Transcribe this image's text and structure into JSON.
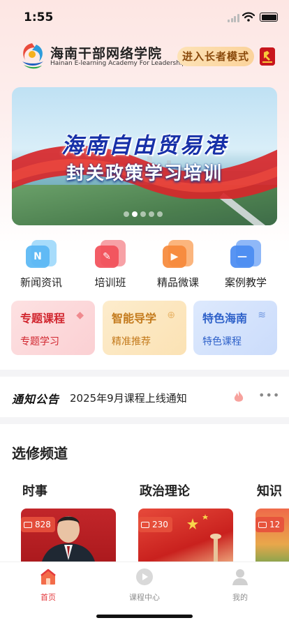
{
  "status_bar": {
    "time": "1:55"
  },
  "header": {
    "brand_cn": "海南干部网络学院",
    "brand_en": "Hainan E-learning Academy For Leadership",
    "elder_mode_label": "进入长者模式",
    "colors": {
      "accent": "#e4393c",
      "elder_btn": "#fbd39b",
      "party_badge": "#c8161d"
    }
  },
  "banner": {
    "title_line1": "海南自由贸易港",
    "title_line2": "封关政策学习培训",
    "slide_count": 5,
    "active_slide": 1
  },
  "quick_menu": [
    {
      "label": "新闻资讯",
      "icon": "news-icon",
      "glyph": "N",
      "color": "#5ab8f5"
    },
    {
      "label": "培训班",
      "icon": "training-class-icon",
      "glyph": "✎",
      "color": "#f2505a"
    },
    {
      "label": "精品微课",
      "icon": "micro-course-icon",
      "glyph": "▶",
      "color": "#f7893a"
    },
    {
      "label": "案例教学",
      "icon": "case-teaching-icon",
      "glyph": "—",
      "color": "#4a8cf2"
    }
  ],
  "feature_cards": [
    {
      "title": "专题课程",
      "subtitle": "专题学习",
      "icon": "tag-icon",
      "glyph": "◆",
      "bg": "#fde1e2",
      "fg": "#d1262f"
    },
    {
      "title": "智能导学",
      "subtitle": "精准推荐",
      "icon": "target-icon",
      "glyph": "⊕",
      "bg": "#fdeccc",
      "fg": "#c37a1c"
    },
    {
      "title": "特色海南",
      "subtitle": "特色课程",
      "icon": "wave-icon",
      "glyph": "≋",
      "bg": "#dde9fd",
      "fg": "#2e61c9"
    }
  ],
  "notice": {
    "label": "通知公告",
    "text": "2025年9月课程上线通知",
    "more": "•••"
  },
  "electives": {
    "title": "选修频道",
    "channels": [
      {
        "name": "时事",
        "count": "828"
      },
      {
        "name": "政治理论",
        "count": "230"
      },
      {
        "name": "知识",
        "count": "12"
      }
    ]
  },
  "tabbar": [
    {
      "label": "首页",
      "icon": "home-icon",
      "active": true
    },
    {
      "label": "课程中心",
      "icon": "play-circle-icon",
      "active": false
    },
    {
      "label": "我的",
      "icon": "user-icon",
      "active": false
    }
  ]
}
